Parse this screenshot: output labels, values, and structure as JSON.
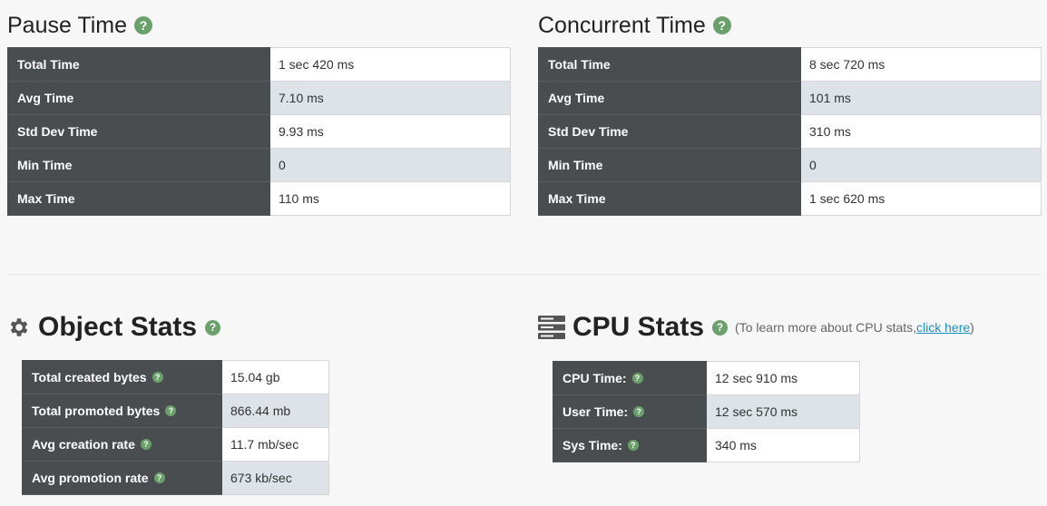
{
  "pause": {
    "title": "Pause Time",
    "rows": [
      {
        "label": "Total Time",
        "value": "1 sec 420 ms"
      },
      {
        "label": "Avg Time",
        "value": "7.10 ms"
      },
      {
        "label": "Std Dev Time",
        "value": "9.93 ms"
      },
      {
        "label": "Min Time",
        "value": "0"
      },
      {
        "label": "Max Time",
        "value": "110 ms"
      }
    ]
  },
  "concurrent": {
    "title": "Concurrent Time",
    "rows": [
      {
        "label": "Total Time",
        "value": "8 sec 720 ms"
      },
      {
        "label": "Avg Time",
        "value": "101 ms"
      },
      {
        "label": "Std Dev Time",
        "value": "310 ms"
      },
      {
        "label": "Min Time",
        "value": "0"
      },
      {
        "label": "Max Time",
        "value": "1 sec 620 ms"
      }
    ]
  },
  "object": {
    "title": "Object Stats",
    "icon": "gear-icon",
    "rows": [
      {
        "label": "Total created bytes",
        "value": "15.04 gb"
      },
      {
        "label": "Total promoted bytes",
        "value": "866.44 mb"
      },
      {
        "label": "Avg creation rate",
        "value": "11.7 mb/sec"
      },
      {
        "label": "Avg promotion rate",
        "value": "673 kb/sec"
      }
    ]
  },
  "cpu": {
    "title": "CPU Stats",
    "icon": "server-icon",
    "note_prefix": "(To learn more about CPU stats, ",
    "note_link": "click here",
    "note_suffix": ")",
    "rows": [
      {
        "label": "CPU Time:",
        "value": "12 sec 910 ms"
      },
      {
        "label": "User Time:",
        "value": "12 sec 570 ms"
      },
      {
        "label": "Sys Time:",
        "value": "340 ms"
      }
    ]
  },
  "help_glyph": "?",
  "colors": {
    "header_cell": "#4a4d50",
    "alt_row": "#dde3e8",
    "help": "#6aa06a",
    "link": "#1a8fc4"
  }
}
